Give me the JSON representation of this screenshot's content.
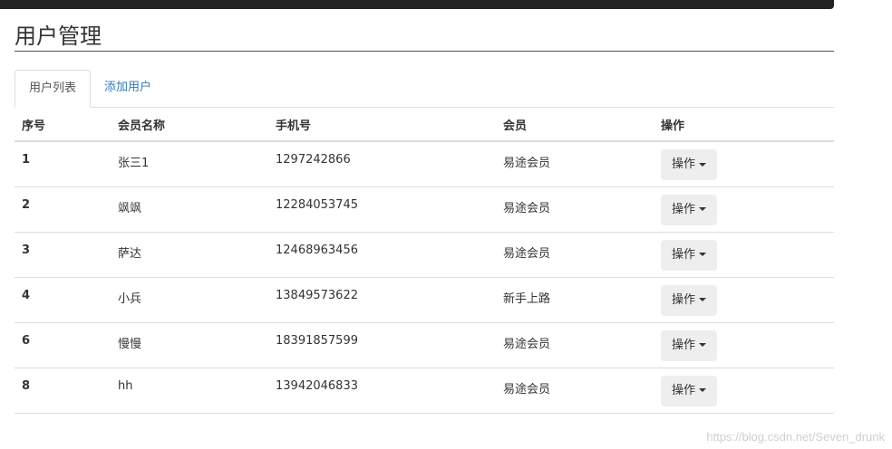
{
  "page": {
    "title": "用户管理"
  },
  "tabs": [
    {
      "label": "用户列表",
      "active": true
    },
    {
      "label": "添加用户",
      "active": false
    }
  ],
  "table": {
    "headers": [
      "序号",
      "会员名称",
      "手机号",
      "会员",
      "操作"
    ],
    "rows": [
      {
        "index": "1",
        "name": "张三1",
        "phone": "1297242866",
        "level": "易途会员",
        "action": "操作"
      },
      {
        "index": "2",
        "name": "飒飒",
        "phone": "12284053745",
        "level": "易途会员",
        "action": "操作"
      },
      {
        "index": "3",
        "name": "萨达",
        "phone": "12468963456",
        "level": "易途会员",
        "action": "操作"
      },
      {
        "index": "4",
        "name": "小兵",
        "phone": "13849573622",
        "level": "新手上路",
        "action": "操作"
      },
      {
        "index": "6",
        "name": "慢慢",
        "phone": "18391857599",
        "level": "易途会员",
        "action": "操作"
      },
      {
        "index": "8",
        "name": "hh",
        "phone": "13942046833",
        "level": "易途会员",
        "action": "操作"
      }
    ]
  },
  "watermark": "https://blog.csdn.net/Seven_drunk",
  "colors": {
    "link": "#337ab7",
    "button_bg": "#eeeeee",
    "topbar": "#222222"
  },
  "icons": {
    "dropdown": "caret-down-icon"
  }
}
